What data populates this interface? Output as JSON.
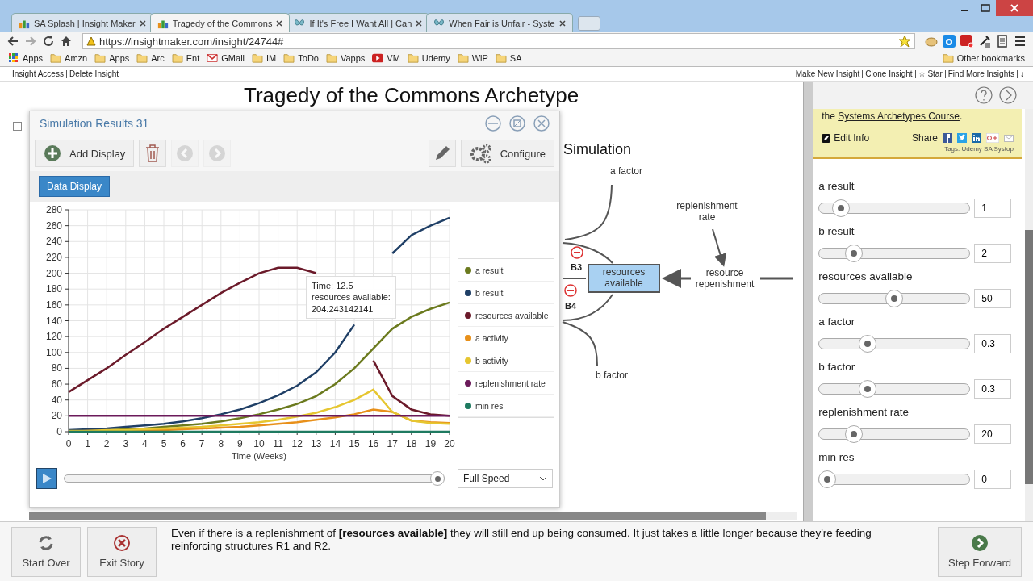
{
  "browser": {
    "tabs": [
      {
        "title": "SA Splash | Insight Maker",
        "kind": "insight",
        "selected": false
      },
      {
        "title": "Tragedy of the Commons",
        "kind": "insight",
        "selected": true
      },
      {
        "title": "If It's Free I Want All | Can",
        "kind": "butterfly",
        "selected": false
      },
      {
        "title": "When Fair is Unfair - Syste",
        "kind": "butterfly",
        "selected": false
      }
    ],
    "url": "https://insightmaker.com/insight/24744#",
    "bookmarks": [
      {
        "label": "Apps",
        "kind": "apps"
      },
      {
        "label": "Amzn",
        "kind": "folder"
      },
      {
        "label": "Apps",
        "kind": "folder"
      },
      {
        "label": "Arc",
        "kind": "folder"
      },
      {
        "label": "Ent",
        "kind": "folder"
      },
      {
        "label": "GMail",
        "kind": "mail"
      },
      {
        "label": "IM",
        "kind": "folder"
      },
      {
        "label": "ToDo",
        "kind": "folder"
      },
      {
        "label": "Vapps",
        "kind": "folder"
      },
      {
        "label": "VM",
        "kind": "video"
      },
      {
        "label": "Udemy",
        "kind": "folder"
      },
      {
        "label": "WiP",
        "kind": "folder"
      },
      {
        "label": "SA",
        "kind": "folder"
      }
    ],
    "other_bookmarks": "Other bookmarks"
  },
  "top_bar": {
    "left_links": [
      "Insight Access",
      "Delete Insight"
    ],
    "right_links": [
      "Make New Insight",
      "Clone Insight",
      "☆ Star",
      "Find More Insights",
      "↓"
    ]
  },
  "canvas": {
    "title": "Tragedy of the Commons Archetype",
    "heading": "Simulation",
    "nodes": [
      {
        "label": "a factor",
        "kind": "variable"
      },
      {
        "label": "replenishment rate",
        "kind": "variable"
      },
      {
        "label": "resources available",
        "kind": "stock"
      },
      {
        "label": "resource repenishment",
        "kind": "flow"
      },
      {
        "label": "b factor",
        "kind": "variable"
      }
    ],
    "loops": [
      "B3",
      "B4"
    ]
  },
  "sim_window": {
    "title": "Simulation Results 31",
    "toolbar": {
      "add_display": "Add Display",
      "configure": "Configure",
      "prev_disabled": true,
      "next_disabled": true
    },
    "tabs": [
      {
        "label": "Data Display",
        "selected": true
      }
    ],
    "chart_data": {
      "type": "line",
      "grid": true,
      "xlabel": "Time (Weeks)",
      "x": [
        0,
        1,
        2,
        3,
        4,
        5,
        6,
        7,
        8,
        9,
        10,
        11,
        12,
        13,
        14,
        15,
        16,
        17,
        18,
        19,
        20
      ],
      "xlim": [
        0,
        20
      ],
      "ylim": [
        0,
        280
      ],
      "xticks": [
        0,
        1,
        2,
        3,
        4,
        5,
        6,
        7,
        8,
        9,
        10,
        11,
        12,
        13,
        14,
        15,
        16,
        17,
        18,
        19,
        20
      ],
      "yticks": [
        0,
        20,
        40,
        60,
        80,
        100,
        120,
        140,
        160,
        180,
        200,
        220,
        240,
        260,
        280
      ],
      "series": [
        {
          "name": "a result",
          "color": "#6b7a1e",
          "values": [
            1,
            2,
            2,
            3,
            4,
            6,
            8,
            10,
            13,
            17,
            22,
            28,
            35,
            45,
            60,
            80,
            105,
            130,
            145,
            155,
            163
          ]
        },
        {
          "name": "b result",
          "color": "#1f3f66",
          "values": [
            2,
            3,
            4,
            6,
            8,
            10,
            13,
            17,
            22,
            28,
            36,
            46,
            58,
            75,
            100,
            135,
            null,
            225,
            248,
            260,
            270
          ]
        },
        {
          "name": "resources available",
          "color": "#6b1a2a",
          "values": [
            50,
            65,
            80,
            97,
            113,
            130,
            145,
            160,
            175,
            188,
            200,
            207,
            207,
            200,
            null,
            null,
            90,
            45,
            28,
            22,
            20
          ]
        },
        {
          "name": "a activity",
          "color": "#e8901a",
          "values": [
            0,
            1,
            1,
            1,
            2,
            2,
            3,
            4,
            5,
            6,
            8,
            10,
            12,
            15,
            18,
            22,
            28,
            25,
            14,
            12,
            11
          ]
        },
        {
          "name": "b activity",
          "color": "#e6c630",
          "values": [
            1,
            1,
            2,
            2,
            3,
            4,
            5,
            6,
            8,
            10,
            12,
            15,
            19,
            24,
            31,
            40,
            53,
            25,
            14,
            11,
            10
          ]
        },
        {
          "name": "replenishment rate",
          "color": "#6b1a5a",
          "values": [
            20,
            20,
            20,
            20,
            20,
            20,
            20,
            20,
            20,
            20,
            20,
            20,
            20,
            20,
            20,
            20,
            20,
            20,
            20,
            20,
            20
          ]
        },
        {
          "name": "min res",
          "color": "#1e7a60",
          "values": [
            0,
            0,
            0,
            0,
            0,
            0,
            0,
            0,
            0,
            0,
            0,
            0,
            0,
            0,
            0,
            0,
            0,
            0,
            0,
            0,
            0
          ]
        }
      ]
    },
    "tooltip": [
      "Time: 12.5",
      "resources available:",
      "204.243142141"
    ],
    "progress": {
      "level": 1
    },
    "speed": "Full Speed"
  },
  "info_panel": {
    "course_before": "the ",
    "course_link": "Systems Archetypes Course",
    "course_after": ".",
    "edit": "Edit Info",
    "share": "Share",
    "tags": "Tags: Udemy SA Systop"
  },
  "sliders": [
    {
      "name": "a result",
      "level": 0.1,
      "value": "1"
    },
    {
      "name": "b result",
      "level": 0.2,
      "value": "2"
    },
    {
      "name": "resources available",
      "level": 0.5,
      "value": "50"
    },
    {
      "name": "a factor",
      "level": 0.3,
      "value": "0.3"
    },
    {
      "name": "b factor",
      "level": 0.3,
      "value": "0.3"
    },
    {
      "name": "replenishment rate",
      "level": 0.2,
      "value": "20"
    },
    {
      "name": "min res",
      "level": 0,
      "value": "0"
    }
  ],
  "story": {
    "buttons": [
      {
        "label": "Start Over",
        "kind": "restart"
      },
      {
        "label": "Exit Story",
        "kind": "exit"
      }
    ],
    "text": "Even if there is a replenishment of **[resources available]** they will still end up being consumed. It just takes a little longer because they're feeding reinforcing structures R1 and R2.",
    "next": "Step Forward"
  }
}
